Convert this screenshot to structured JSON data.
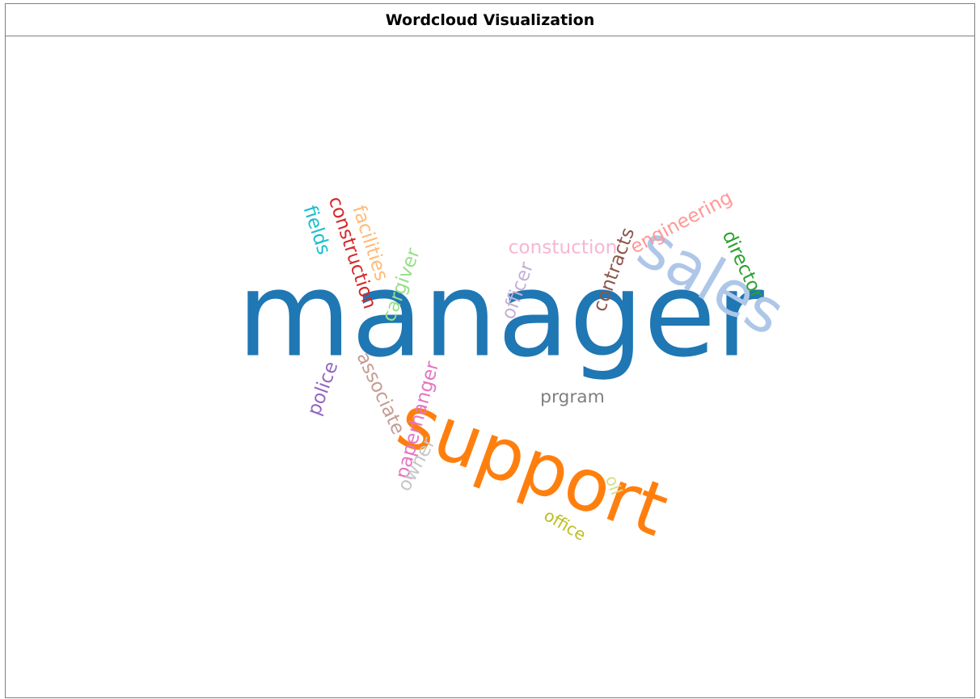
{
  "header": {
    "title": "Wordcloud Visualization"
  },
  "chart_data": {
    "type": "wordcloud",
    "title": "Wordcloud Visualization",
    "words": [
      {
        "text": "manager",
        "weight": 100,
        "color": "#1f77b4",
        "rotation": 0
      },
      {
        "text": "support",
        "weight": 62,
        "color": "#ff7f0e",
        "rotation": 20
      },
      {
        "text": "sales",
        "weight": 52,
        "color": "#aec7e8",
        "rotation": 30
      },
      {
        "text": "constuction",
        "weight": 16,
        "color": "#f7b6d2",
        "rotation": 0
      },
      {
        "text": "contracts",
        "weight": 16,
        "color": "#8c564b",
        "rotation": -70
      },
      {
        "text": "engineering",
        "weight": 16,
        "color": "#ff9896",
        "rotation": -28
      },
      {
        "text": "director",
        "weight": 16,
        "color": "#2ca02c",
        "rotation": 65
      },
      {
        "text": "fields",
        "weight": 16,
        "color": "#17becf",
        "rotation": 72
      },
      {
        "text": "construction",
        "weight": 16,
        "color": "#d62728",
        "rotation": 72
      },
      {
        "text": "facilities",
        "weight": 16,
        "color": "#ffbb78",
        "rotation": 72
      },
      {
        "text": "cargiver",
        "weight": 16,
        "color": "#98df8a",
        "rotation": -70
      },
      {
        "text": "officer",
        "weight": 16,
        "color": "#c5b0d5",
        "rotation": -70
      },
      {
        "text": "police",
        "weight": 16,
        "color": "#9467bd",
        "rotation": -70
      },
      {
        "text": "associate",
        "weight": 16,
        "color": "#c49c94",
        "rotation": 65
      },
      {
        "text": "prgram",
        "weight": 15,
        "color": "#7f7f7f",
        "rotation": 0
      },
      {
        "text": "paperhanger",
        "weight": 16,
        "color": "#e377c2",
        "rotation": -75
      },
      {
        "text": "owner",
        "weight": 16,
        "color": "#c7c7c7",
        "rotation": -62
      },
      {
        "text": "oil",
        "weight": 14,
        "color": "#dbdb8d",
        "rotation": 70
      },
      {
        "text": "office",
        "weight": 14,
        "color": "#bcbd22",
        "rotation": 30
      }
    ]
  }
}
